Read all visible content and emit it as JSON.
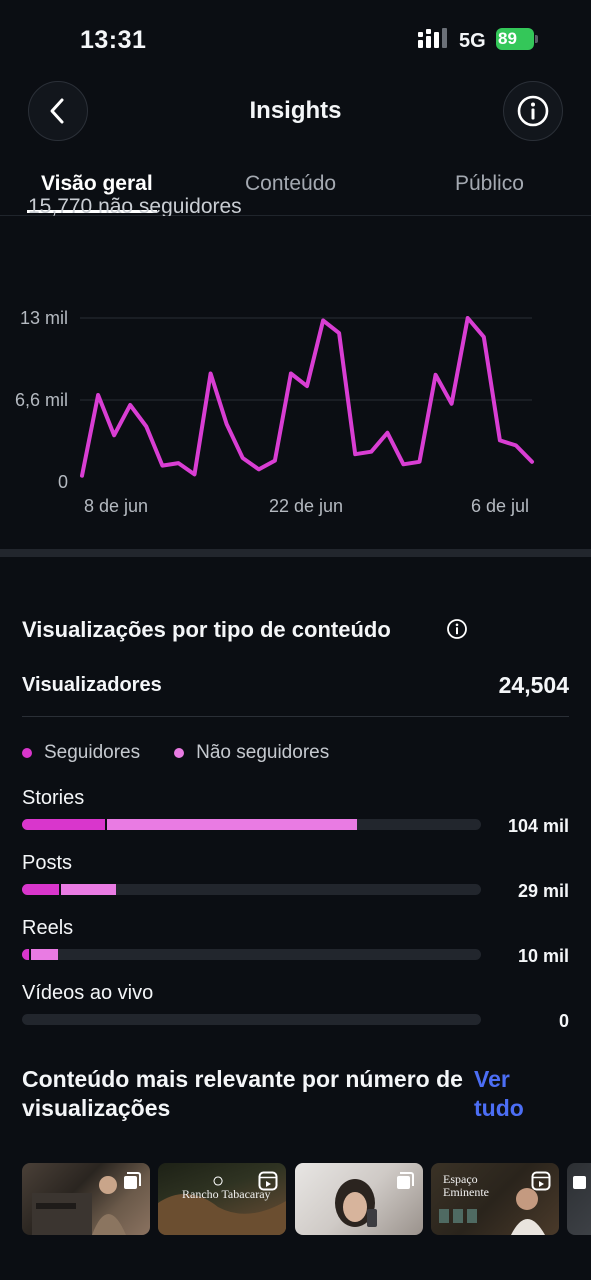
{
  "status_bar": {
    "time": "13:31",
    "network": "5G",
    "battery": "89"
  },
  "header": {
    "title": "Insights"
  },
  "tabs": [
    {
      "label": "Visão geral",
      "active": true
    },
    {
      "label": "Conteúdo",
      "active": false
    },
    {
      "label": "Público",
      "active": false
    }
  ],
  "cut_text": "15,770 não seguidores",
  "chart_data": {
    "type": "line",
    "color": "#d93ed3",
    "y_ticks": [
      "0",
      "6,6 mil",
      "13 mil"
    ],
    "ylim": [
      0,
      13000
    ],
    "x_ticks": [
      "8 de jun",
      "22 de jun",
      "6 de jul"
    ],
    "grid": true,
    "values": [
      500,
      6900,
      3700,
      6100,
      4400,
      1300,
      1500,
      600,
      8600,
      4600,
      1900,
      1000,
      1700,
      8600,
      7600,
      12800,
      11800,
      2200,
      2400,
      3900,
      1400,
      1600,
      8500,
      6200,
      13000,
      11500,
      3300,
      2900,
      1600
    ]
  },
  "views_section": {
    "title": "Visualizações por tipo de conteúdo",
    "viewers_label": "Visualizadores",
    "viewers_value": "24,504",
    "legend": [
      {
        "label": "Seguidores",
        "color": "#d936cc"
      },
      {
        "label": "Não seguidores",
        "color": "#e97be3"
      }
    ],
    "rows": [
      {
        "label": "Stories",
        "value": "104 mil",
        "followers_fraction": 0.18,
        "total_fraction": 0.73
      },
      {
        "label": "Posts",
        "value": "29 mil",
        "followers_fraction": 0.08,
        "total_fraction": 0.205
      },
      {
        "label": "Reels",
        "value": "10 mil",
        "followers_fraction": 0.015,
        "total_fraction": 0.078
      },
      {
        "label": "Vídeos ao vivo",
        "value": "0",
        "followers_fraction": 0,
        "total_fraction": 0
      }
    ]
  },
  "relevant_section": {
    "title": "Conteúdo mais relevante por número de visualizações",
    "see_all": "Ver tudo",
    "thumbnails": [
      {
        "type": "carousel",
        "caption": ""
      },
      {
        "type": "reel",
        "caption": "Rancho Tabacaray"
      },
      {
        "type": "carousel",
        "caption": ""
      },
      {
        "type": "reel",
        "caption": "Espaço Eminente"
      },
      {
        "type": "carousel",
        "caption": ""
      }
    ]
  }
}
